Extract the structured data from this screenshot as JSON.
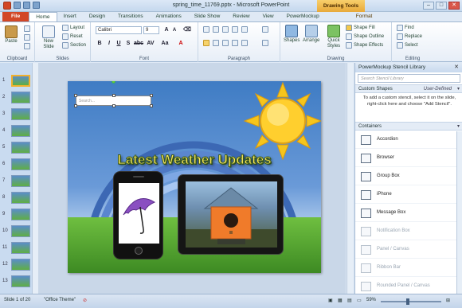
{
  "window": {
    "title": "spring_time_11769.pptx - Microsoft PowerPoint",
    "contextual_tab": "Drawing Tools",
    "min": "–",
    "max": "□",
    "close": "✕"
  },
  "tabs": [
    "File",
    "Home",
    "Insert",
    "Design",
    "Transitions",
    "Animations",
    "Slide Show",
    "Review",
    "View",
    "PowerMockup",
    "Format"
  ],
  "ribbon": {
    "clipboard": {
      "paste": "Paste",
      "label": "Clipboard"
    },
    "slides": {
      "new_slide": "New Slide",
      "layout": "Layout",
      "reset": "Reset",
      "section": "Section",
      "label": "Slides"
    },
    "font": {
      "name": "Calibri",
      "size": "9",
      "label": "Font"
    },
    "paragraph": {
      "label": "Paragraph"
    },
    "drawing": {
      "shapes": "Shapes",
      "arrange": "Arrange",
      "quick_styles": "Quick Styles",
      "shape_fill": "Shape Fill",
      "shape_outline": "Shape Outline",
      "shape_effects": "Shape Effects",
      "label": "Drawing"
    },
    "editing": {
      "find": "Find",
      "replace": "Replace",
      "select": "Select",
      "label": "Editing"
    }
  },
  "slide_numbers": [
    "1",
    "2",
    "3",
    "4",
    "5",
    "6",
    "7",
    "8",
    "9",
    "10",
    "11",
    "12",
    "13"
  ],
  "slide": {
    "headline": "Latest Weather Updates",
    "search_placeholder": "Search..."
  },
  "stencil": {
    "title": "PowerMockup Stencil Library",
    "search_placeholder": "Search Stencil Library",
    "custom_shapes": "Custom Shapes",
    "user_defined": "User-Defined",
    "help": "To add a custom stencil, select it on the slide, right-click here and choose \"Add Stencil\".",
    "containers": "Containers",
    "items": [
      {
        "label": "Accordion",
        "enabled": true
      },
      {
        "label": "Browser",
        "enabled": true
      },
      {
        "label": "Group Box",
        "enabled": true
      },
      {
        "label": "iPhone",
        "enabled": true
      },
      {
        "label": "Message Box",
        "enabled": true
      },
      {
        "label": "Notification Box",
        "enabled": false
      },
      {
        "label": "Panel / Canvas",
        "enabled": false
      },
      {
        "label": "Ribbon Bar",
        "enabled": false
      },
      {
        "label": "Rounded Panel / Canvas",
        "enabled": false
      }
    ]
  },
  "status": {
    "slide": "Slide 1 of 20",
    "theme": "\"Office Theme\"",
    "zoom": "59%"
  },
  "colors": {
    "file_tab": "#d24726",
    "drawing_tools": "#f2b12e",
    "accent": "#3f7cc4"
  }
}
